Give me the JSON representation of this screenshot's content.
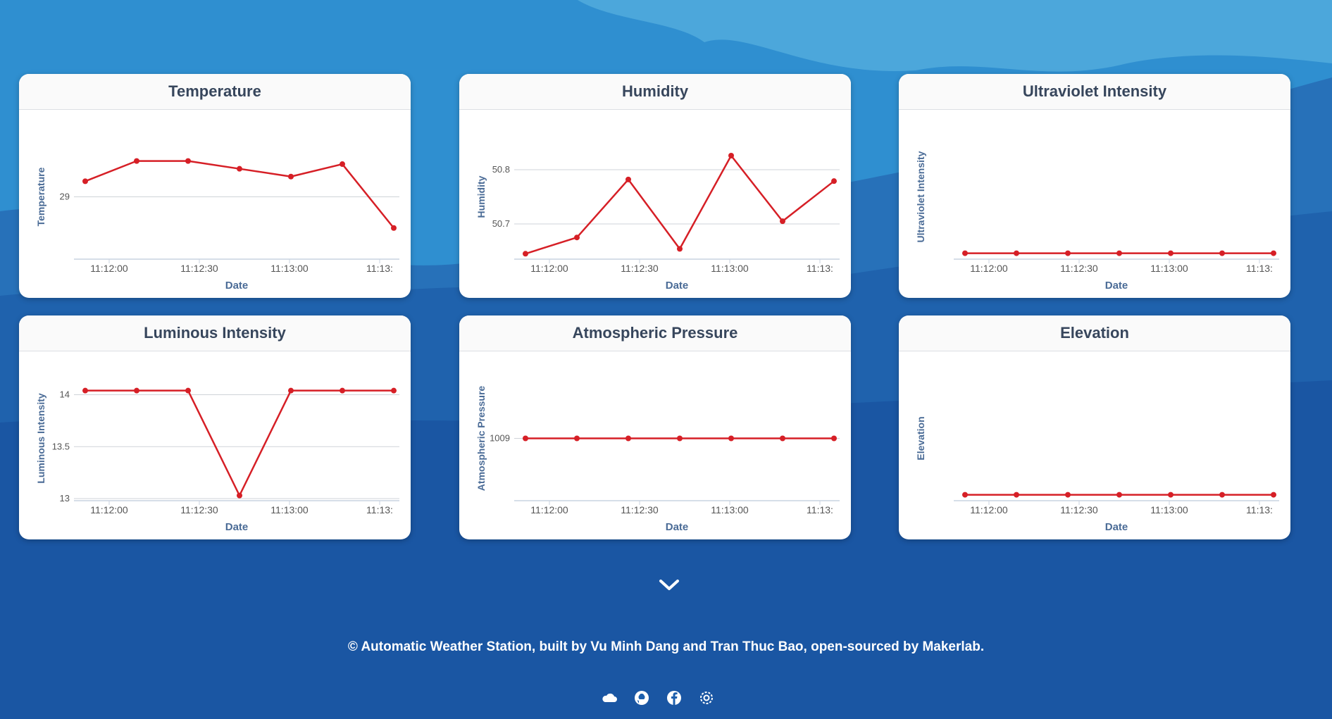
{
  "charts": [
    {
      "id": "temperature",
      "title": "Temperature",
      "ylabel": "Temperature",
      "xlabel": "Date",
      "ticks_y": [
        {
          "v": 29,
          "label": "29"
        }
      ],
      "ylim": [
        28.6,
        29.4
      ],
      "values": [
        29.1,
        29.23,
        29.23,
        29.18,
        29.13,
        29.21,
        28.8
      ]
    },
    {
      "id": "humidity",
      "title": "Humidity",
      "ylabel": "Humidity",
      "xlabel": "Date",
      "ticks_y": [
        {
          "v": 50.8,
          "label": "50.8"
        },
        {
          "v": 50.7,
          "label": "50.7"
        }
      ],
      "ylim": [
        50.635,
        50.865
      ],
      "values": [
        50.645,
        50.675,
        50.782,
        50.654,
        50.826,
        50.705,
        50.779
      ]
    },
    {
      "id": "uv",
      "title": "Ultraviolet Intensity",
      "ylabel": "Ultraviolet Intensity",
      "xlabel": "Date",
      "ticks_y": [],
      "ylim": [
        -0.05,
        1
      ],
      "values": [
        0,
        0,
        0,
        0,
        0,
        0,
        0
      ]
    },
    {
      "id": "luminous",
      "title": "Luminous Intensity",
      "ylabel": "Luminous Intensity",
      "xlabel": "Date",
      "ticks_y": [
        {
          "v": 14,
          "label": "14"
        },
        {
          "v": 13.5,
          "label": "13.5"
        },
        {
          "v": 13,
          "label": "13"
        }
      ],
      "ylim": [
        12.98,
        14.18
      ],
      "values": [
        14.04,
        14.04,
        14.04,
        13.03,
        14.04,
        14.04,
        14.04
      ]
    },
    {
      "id": "pressure",
      "title": "Atmospheric Pressure",
      "ylabel": "Atmospheric Pressure",
      "xlabel": "Date",
      "ticks_y": [
        {
          "v": 1009,
          "label": "1009"
        }
      ],
      "ylim": [
        1008,
        1010
      ],
      "values": [
        1009,
        1009,
        1009,
        1009,
        1009,
        1009,
        1009
      ]
    },
    {
      "id": "elevation",
      "title": "Elevation",
      "ylabel": "Elevation",
      "xlabel": "Date",
      "ticks_y": [],
      "ylim": [
        -0.05,
        1
      ],
      "values": [
        0,
        0,
        0,
        0,
        0,
        0,
        0
      ]
    }
  ],
  "x_tick_labels": [
    "11:12:00",
    "11:12:30",
    "11:13:00",
    "11:13:"
  ],
  "footer": "© Automatic Weather Station, built by Vu Minh Dang and Tran Thuc Bao, open-sourced by Makerlab.",
  "social_icons": [
    "cloud-icon",
    "github-icon",
    "facebook-icon",
    "settings-icon"
  ],
  "colors": {
    "series": "#d61f26",
    "axis_text": "#4a6b96",
    "title": "#37465c"
  }
}
